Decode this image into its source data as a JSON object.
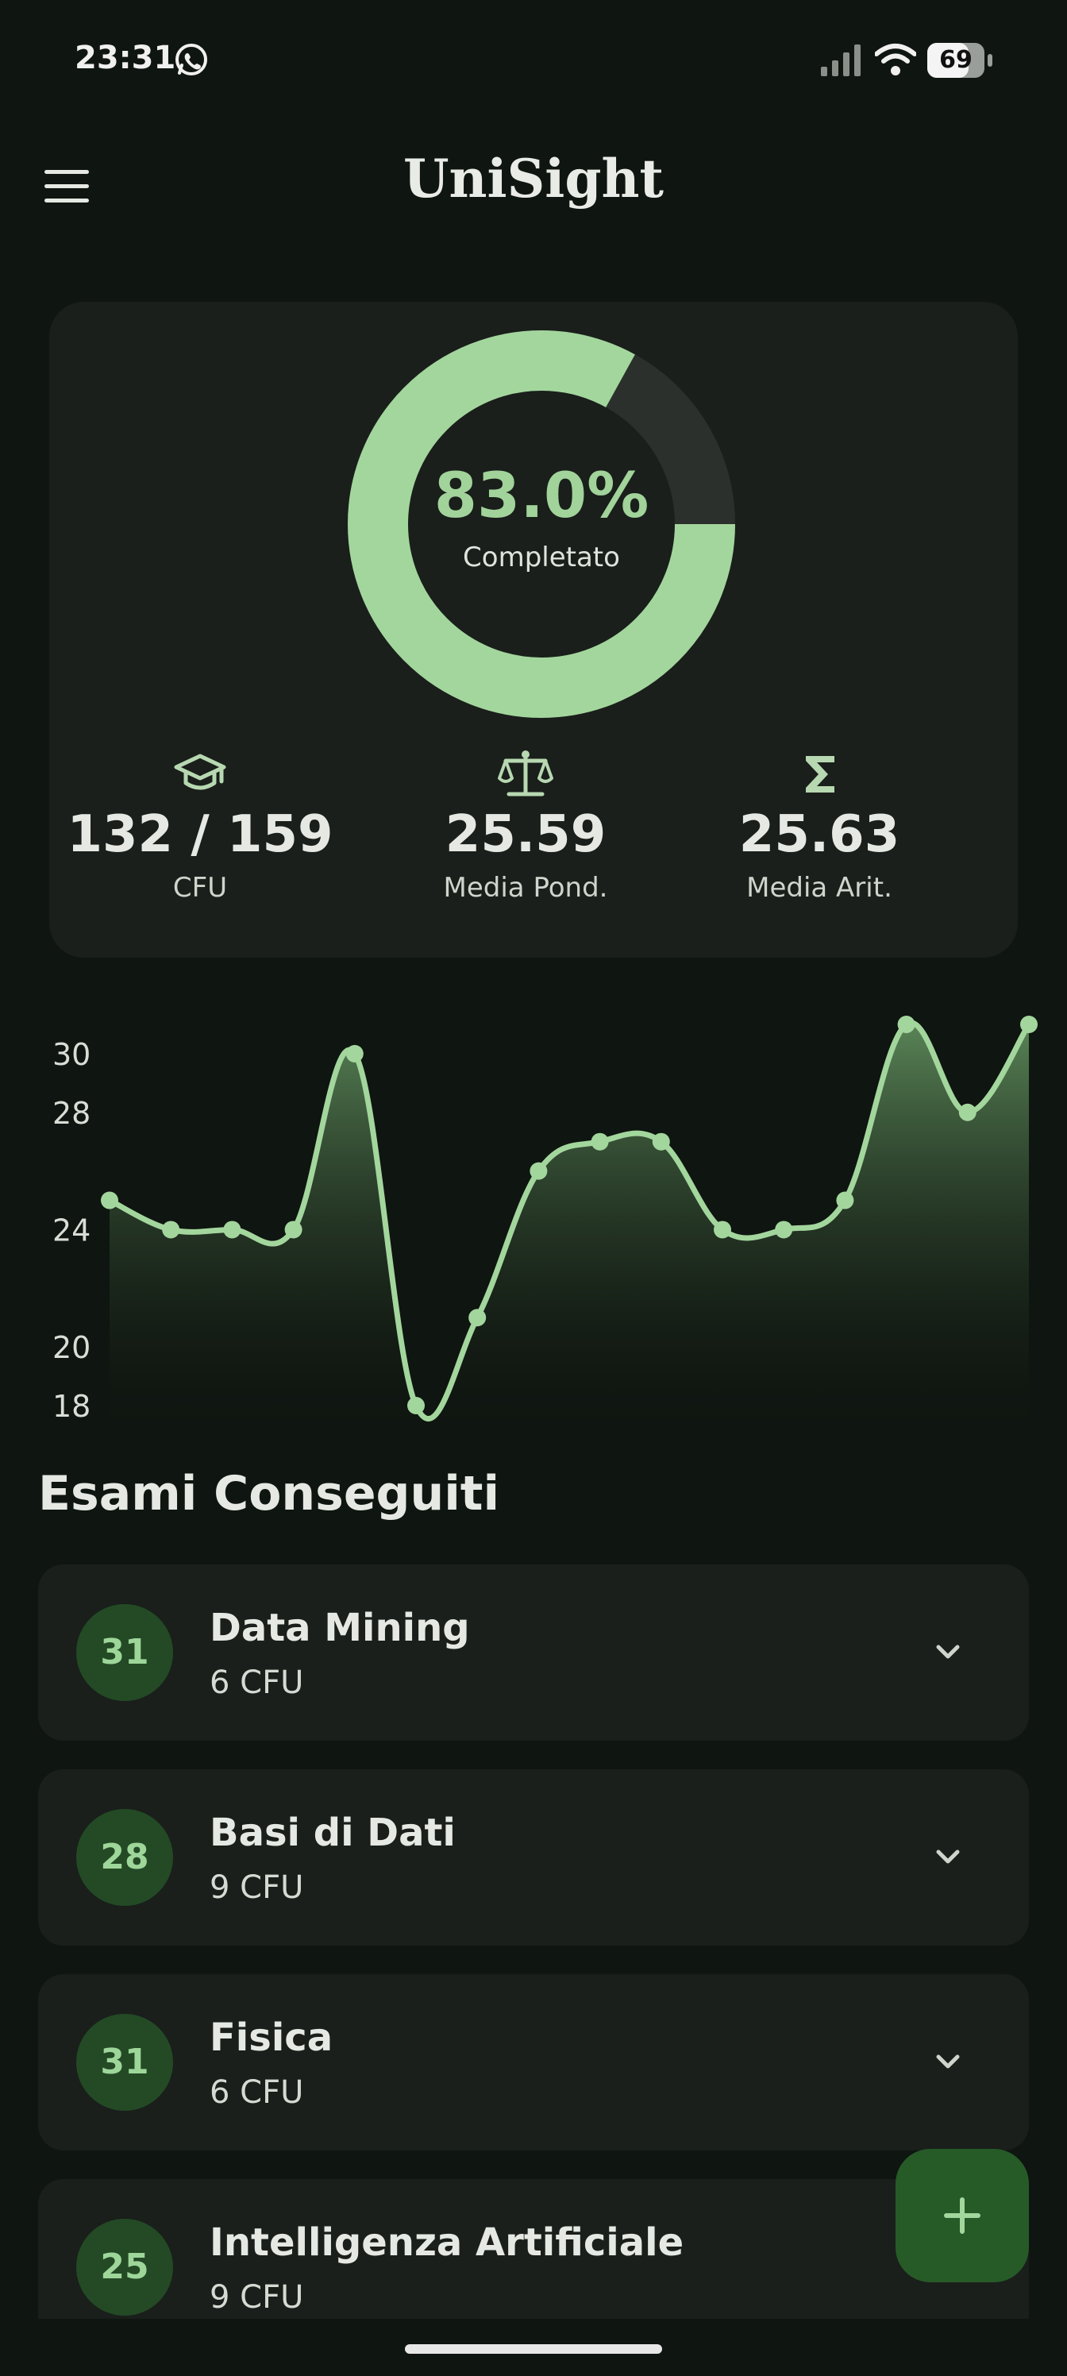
{
  "status_bar": {
    "time": "23:31",
    "battery": "69",
    "icons": [
      "whatsapp-icon",
      "signal-icon",
      "wifi-icon",
      "battery-icon"
    ]
  },
  "app_bar": {
    "title": "UniSight",
    "menu_icon": "menu-icon"
  },
  "summary": {
    "progress_percent": 83.0,
    "progress_label": "83.0%",
    "progress_caption": "Completato",
    "stats": [
      {
        "icon": "graduation-cap-icon",
        "value": "132 / 159",
        "label": "CFU"
      },
      {
        "icon": "scale-icon",
        "value": "25.59",
        "label": "Media Pond."
      },
      {
        "icon": "sigma-icon",
        "value": "25.63",
        "label": "Media Arit."
      }
    ]
  },
  "chart_data": {
    "type": "area",
    "title": "",
    "xlabel": "",
    "ylabel": "",
    "y_ticks": [
      "30",
      "28",
      "24",
      "20",
      "18"
    ],
    "ylim": [
      18,
      31
    ],
    "values": [
      25,
      24,
      24,
      24,
      30,
      18,
      21,
      26,
      27,
      27,
      24,
      24,
      25,
      31,
      28,
      31
    ],
    "grid": false,
    "color": "#a3d69d"
  },
  "section": {
    "title": "Esami Conseguiti"
  },
  "exams": [
    {
      "grade": "31",
      "name": "Data Mining",
      "cfu": "6 CFU"
    },
    {
      "grade": "28",
      "name": "Basi di Dati",
      "cfu": "9 CFU"
    },
    {
      "grade": "31",
      "name": "Fisica",
      "cfu": "6 CFU"
    },
    {
      "grade": "25",
      "name": "Intelligenza Artificiale",
      "cfu": "9 CFU"
    }
  ],
  "fab": {
    "icon": "plus-icon"
  },
  "colors": {
    "background": "#0f1510",
    "card": "#1a1f1b",
    "accent": "#a1d39a",
    "grade_badge": "#234a25",
    "fab": "#265b28"
  }
}
